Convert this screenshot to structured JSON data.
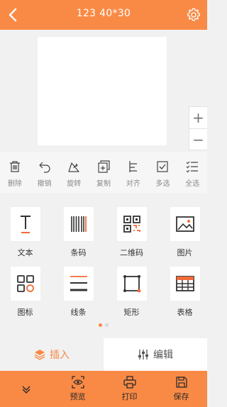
{
  "header": {
    "title": "123  40*30",
    "back_icon": "chevron-left-icon",
    "settings_icon": "gear-icon"
  },
  "zoom": {
    "in_label": "+",
    "out_label": "−"
  },
  "toolbar": {
    "items": [
      {
        "label": "删除",
        "icon": "trash-icon"
      },
      {
        "label": "撤销",
        "icon": "undo-icon"
      },
      {
        "label": "旋转",
        "icon": "rotate-icon"
      },
      {
        "label": "复制",
        "icon": "copy-icon"
      },
      {
        "label": "对齐",
        "icon": "align-icon"
      },
      {
        "label": "多选",
        "icon": "checkbox-icon"
      },
      {
        "label": "全选",
        "icon": "select-all-icon"
      }
    ]
  },
  "palette": {
    "items": [
      {
        "label": "文本",
        "icon": "text-icon"
      },
      {
        "label": "条码",
        "icon": "barcode-icon"
      },
      {
        "label": "二维码",
        "icon": "qrcode-icon"
      },
      {
        "label": "图片",
        "icon": "image-icon"
      },
      {
        "label": "图标",
        "icon": "grid-icon"
      },
      {
        "label": "线条",
        "icon": "lines-icon"
      },
      {
        "label": "矩形",
        "icon": "rectangle-icon"
      },
      {
        "label": "表格",
        "icon": "table-icon"
      }
    ],
    "page_count": 2,
    "active_page": 1
  },
  "modes": {
    "insert_label": "插入",
    "edit_label": "编辑",
    "active": "insert"
  },
  "bottom": {
    "preview_label": "预览",
    "print_label": "打印",
    "save_label": "保存"
  },
  "colors": {
    "accent": "#f98a45",
    "icon_dark": "#333333",
    "icon_red": "#f26b3a"
  }
}
